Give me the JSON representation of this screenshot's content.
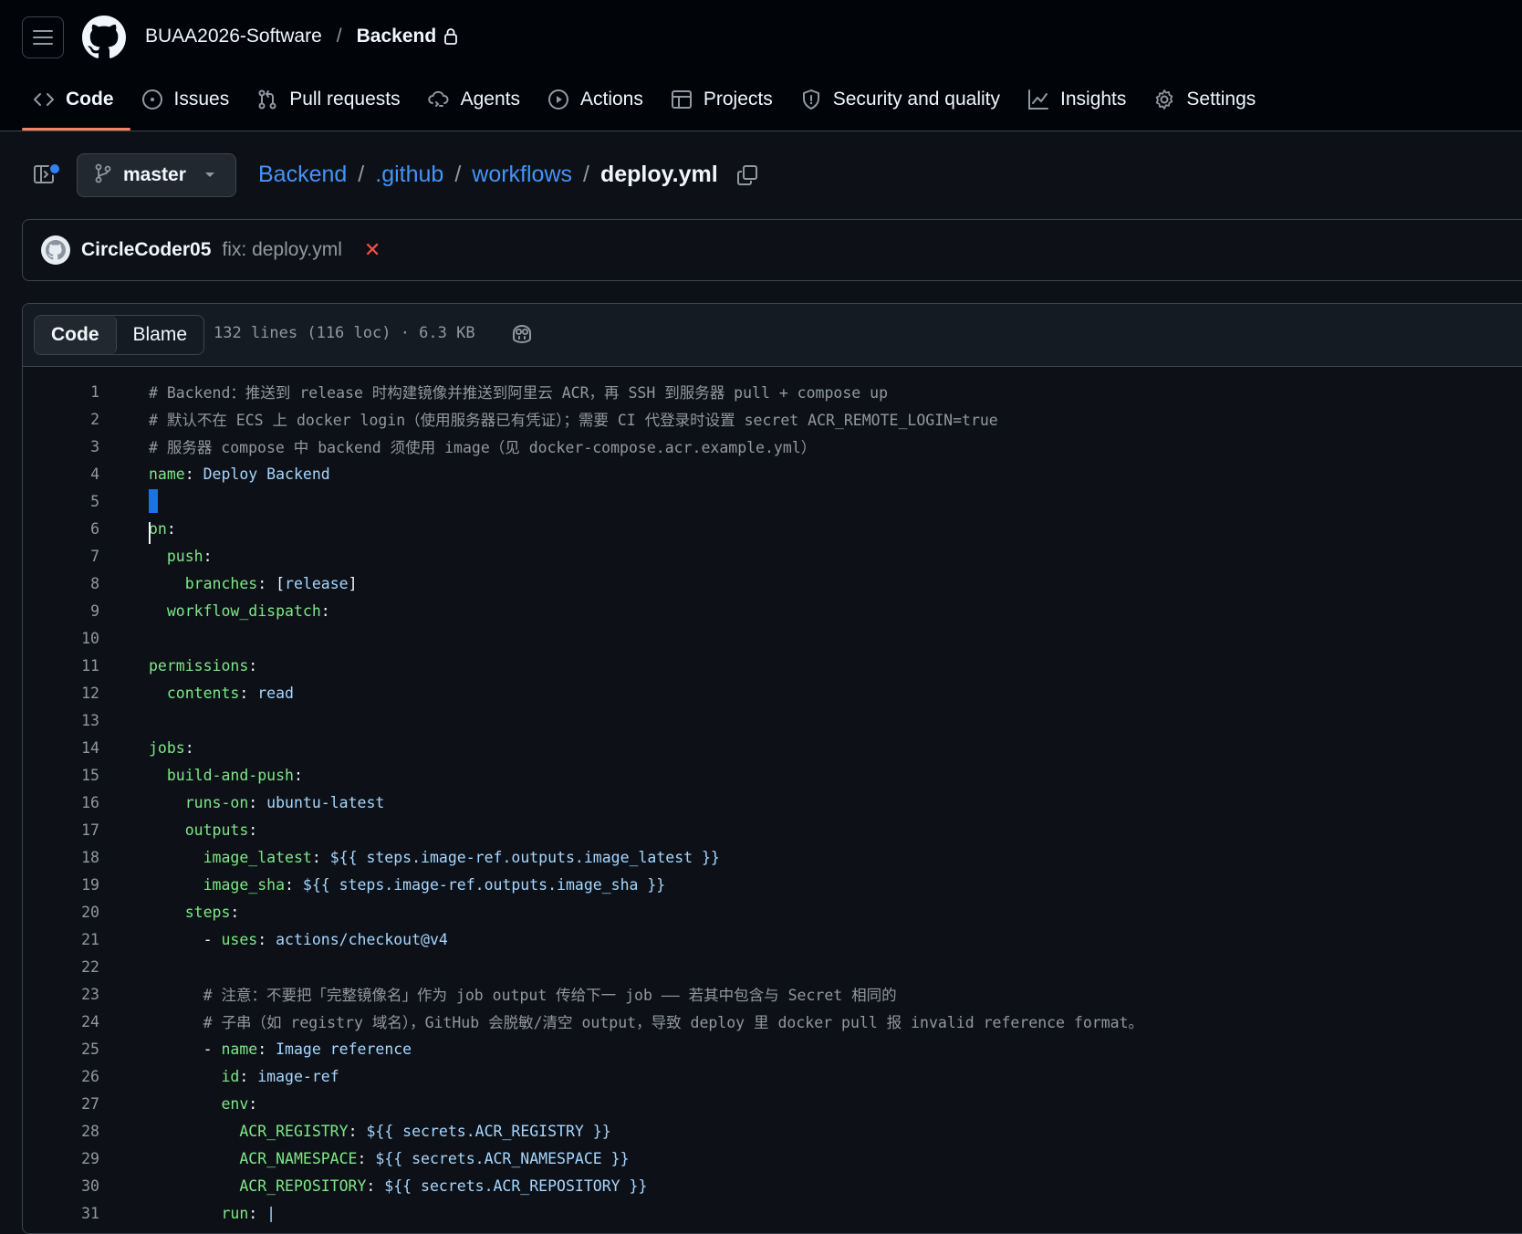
{
  "header": {
    "owner": "BUAA2026-Software",
    "separator": "/",
    "repo": "Backend"
  },
  "nav": {
    "tabs": [
      {
        "label": "Code",
        "icon": "code-icon",
        "active": true
      },
      {
        "label": "Issues",
        "icon": "issue-icon"
      },
      {
        "label": "Pull requests",
        "icon": "pull-request-icon"
      },
      {
        "label": "Agents",
        "icon": "agents-icon"
      },
      {
        "label": "Actions",
        "icon": "play-icon"
      },
      {
        "label": "Projects",
        "icon": "table-icon"
      },
      {
        "label": "Security and quality",
        "icon": "shield-icon"
      },
      {
        "label": "Insights",
        "icon": "graph-icon"
      },
      {
        "label": "Settings",
        "icon": "gear-icon"
      }
    ],
    "accent": "#f78166"
  },
  "file_header": {
    "branch": "master",
    "path": [
      ".github",
      "workflows"
    ],
    "root": "Backend",
    "file": "deploy.yml",
    "sep": "/"
  },
  "commit": {
    "author": "CircleCoder05",
    "message": "fix: deploy.yml",
    "status_icon": "x-icon",
    "status_color": "#f85149"
  },
  "code_view": {
    "tabs": [
      "Code",
      "Blame"
    ],
    "active_tab": "Code",
    "meta": "132 lines (116 loc) · 6.3 KB"
  },
  "code": {
    "lines": [
      {
        "n": "1",
        "parts": [
          [
            "c",
            "# Backend：推送到 release 时构建镜像并推送到阿里云 ACR，再 SSH 到服务器 pull + compose up"
          ]
        ]
      },
      {
        "n": "2",
        "parts": [
          [
            "c",
            "# 默认不在 ECS 上 docker login（使用服务器已有凭证）；需要 CI 代登录时设置 secret ACR_REMOTE_LOGIN=true"
          ]
        ]
      },
      {
        "n": "3",
        "parts": [
          [
            "c",
            "# 服务器 compose 中 backend 须使用 image（见 docker-compose.acr.example.yml）"
          ]
        ]
      },
      {
        "n": "4",
        "parts": [
          [
            "k",
            "name"
          ],
          [
            "p",
            ": "
          ],
          [
            "s",
            "Deploy Backend"
          ]
        ]
      },
      {
        "n": "5",
        "parts": [
          [
            "sel",
            ""
          ]
        ]
      },
      {
        "n": "6",
        "parts": [
          [
            "k",
            "on"
          ],
          [
            "p",
            ":"
          ]
        ],
        "caret": true
      },
      {
        "n": "7",
        "parts": [
          [
            "p",
            "  "
          ],
          [
            "k",
            "push"
          ],
          [
            "p",
            ":"
          ]
        ]
      },
      {
        "n": "8",
        "parts": [
          [
            "p",
            "    "
          ],
          [
            "k",
            "branches"
          ],
          [
            "p",
            ": ["
          ],
          [
            "s",
            "release"
          ],
          [
            "p",
            "]"
          ]
        ]
      },
      {
        "n": "9",
        "parts": [
          [
            "p",
            "  "
          ],
          [
            "k",
            "workflow_dispatch"
          ],
          [
            "p",
            ":"
          ]
        ]
      },
      {
        "n": "10",
        "parts": []
      },
      {
        "n": "11",
        "parts": [
          [
            "k",
            "permissions"
          ],
          [
            "p",
            ":"
          ]
        ]
      },
      {
        "n": "12",
        "parts": [
          [
            "p",
            "  "
          ],
          [
            "k",
            "contents"
          ],
          [
            "p",
            ": "
          ],
          [
            "s",
            "read"
          ]
        ]
      },
      {
        "n": "13",
        "parts": []
      },
      {
        "n": "14",
        "parts": [
          [
            "k",
            "jobs"
          ],
          [
            "p",
            ":"
          ]
        ]
      },
      {
        "n": "15",
        "parts": [
          [
            "p",
            "  "
          ],
          [
            "k",
            "build-and-push"
          ],
          [
            "p",
            ":"
          ]
        ]
      },
      {
        "n": "16",
        "parts": [
          [
            "p",
            "    "
          ],
          [
            "k",
            "runs-on"
          ],
          [
            "p",
            ": "
          ],
          [
            "s",
            "ubuntu-latest"
          ]
        ]
      },
      {
        "n": "17",
        "parts": [
          [
            "p",
            "    "
          ],
          [
            "k",
            "outputs"
          ],
          [
            "p",
            ":"
          ]
        ]
      },
      {
        "n": "18",
        "parts": [
          [
            "p",
            "      "
          ],
          [
            "k",
            "image_latest"
          ],
          [
            "p",
            ": "
          ],
          [
            "s",
            "${{ steps.image-ref.outputs.image_latest }}"
          ]
        ]
      },
      {
        "n": "19",
        "parts": [
          [
            "p",
            "      "
          ],
          [
            "k",
            "image_sha"
          ],
          [
            "p",
            ": "
          ],
          [
            "s",
            "${{ steps.image-ref.outputs.image_sha }}"
          ]
        ]
      },
      {
        "n": "20",
        "parts": [
          [
            "p",
            "    "
          ],
          [
            "k",
            "steps"
          ],
          [
            "p",
            ":"
          ]
        ]
      },
      {
        "n": "21",
        "parts": [
          [
            "p",
            "      - "
          ],
          [
            "k",
            "uses"
          ],
          [
            "p",
            ": "
          ],
          [
            "s",
            "actions/checkout@v4"
          ]
        ]
      },
      {
        "n": "22",
        "parts": []
      },
      {
        "n": "23",
        "parts": [
          [
            "p",
            "      "
          ],
          [
            "c",
            "# 注意：不要把「完整镜像名」作为 job output 传给下一 job —— 若其中包含与 Secret 相同的"
          ]
        ]
      },
      {
        "n": "24",
        "parts": [
          [
            "p",
            "      "
          ],
          [
            "c",
            "# 子串（如 registry 域名），GitHub 会脱敏/清空 output，导致 deploy 里 docker pull 报 invalid reference format。"
          ]
        ]
      },
      {
        "n": "25",
        "parts": [
          [
            "p",
            "      - "
          ],
          [
            "k",
            "name"
          ],
          [
            "p",
            ": "
          ],
          [
            "s",
            "Image reference"
          ]
        ]
      },
      {
        "n": "26",
        "parts": [
          [
            "p",
            "        "
          ],
          [
            "k",
            "id"
          ],
          [
            "p",
            ": "
          ],
          [
            "s",
            "image-ref"
          ]
        ]
      },
      {
        "n": "27",
        "parts": [
          [
            "p",
            "        "
          ],
          [
            "k",
            "env"
          ],
          [
            "p",
            ":"
          ]
        ]
      },
      {
        "n": "28",
        "parts": [
          [
            "p",
            "          "
          ],
          [
            "k",
            "ACR_REGISTRY"
          ],
          [
            "p",
            ": "
          ],
          [
            "s",
            "${{ secrets.ACR_REGISTRY }}"
          ]
        ]
      },
      {
        "n": "29",
        "parts": [
          [
            "p",
            "          "
          ],
          [
            "k",
            "ACR_NAMESPACE"
          ],
          [
            "p",
            ": "
          ],
          [
            "s",
            "${{ secrets.ACR_NAMESPACE }}"
          ]
        ]
      },
      {
        "n": "30",
        "parts": [
          [
            "p",
            "          "
          ],
          [
            "k",
            "ACR_REPOSITORY"
          ],
          [
            "p",
            ": "
          ],
          [
            "s",
            "${{ secrets.ACR_REPOSITORY }}"
          ]
        ]
      },
      {
        "n": "31",
        "parts": [
          [
            "p",
            "        "
          ],
          [
            "k",
            "run"
          ],
          [
            "p",
            ": "
          ],
          [
            "s",
            "|"
          ]
        ]
      }
    ]
  }
}
